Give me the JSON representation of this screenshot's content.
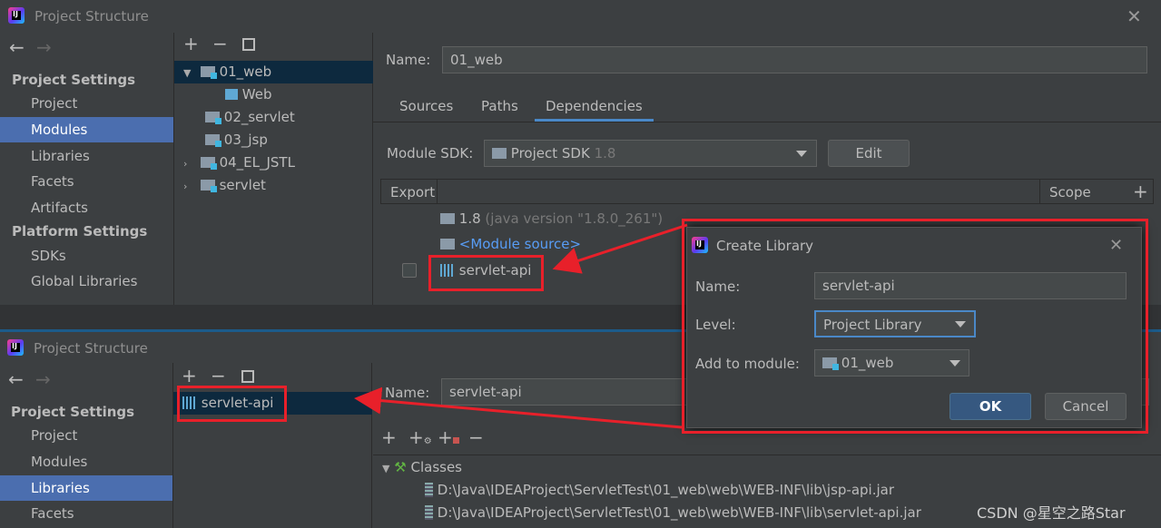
{
  "top": {
    "title": "Project Structure",
    "nav": {
      "section1": "Project Settings",
      "items1": [
        "Project",
        "Modules",
        "Libraries",
        "Facets",
        "Artifacts"
      ],
      "section2": "Platform Settings",
      "items2": [
        "SDKs",
        "Global Libraries"
      ]
    },
    "tree": [
      "01_web",
      "Web",
      "02_servlet",
      "03_jsp",
      "04_EL_JSTL",
      "servlet"
    ],
    "name_label": "Name:",
    "name_value": "01_web",
    "tabs": [
      "Sources",
      "Paths",
      "Dependencies"
    ],
    "sdk_label": "Module SDK:",
    "sdk_value": "Project SDK",
    "sdk_version": "1.8",
    "edit_button": "Edit",
    "table_headers": {
      "export": "Export",
      "scope": "Scope"
    },
    "deps": [
      {
        "name": "1.8",
        "detail": "(java version \"1.8.0_261\")"
      },
      {
        "name": "<Module source>"
      },
      {
        "name": "servlet-api"
      }
    ]
  },
  "dialog": {
    "title": "Create Library",
    "name_label": "Name:",
    "name_value": "servlet-api",
    "level_label": "Level:",
    "level_value": "Project Library",
    "module_label": "Add to module:",
    "module_value": "01_web",
    "ok": "OK",
    "cancel": "Cancel"
  },
  "bottom": {
    "title": "Project Structure",
    "nav": {
      "section1": "Project Settings",
      "items1": [
        "Project",
        "Modules",
        "Libraries",
        "Facets"
      ]
    },
    "library": "servlet-api",
    "name_label": "Name:",
    "name_value": "servlet-api",
    "classes_label": "Classes",
    "jars": [
      "D:\\Java\\IDEAProject\\ServletTest\\01_web\\web\\WEB-INF\\lib\\jsp-api.jar",
      "D:\\Java\\IDEAProject\\ServletTest\\01_web\\web\\WEB-INF\\lib\\servlet-api.jar"
    ]
  },
  "watermark": "CSDN @星空之路Star",
  "colors": {
    "accent": "#4b6eaf",
    "highlight": "#e8202a",
    "link": "#589df6"
  }
}
